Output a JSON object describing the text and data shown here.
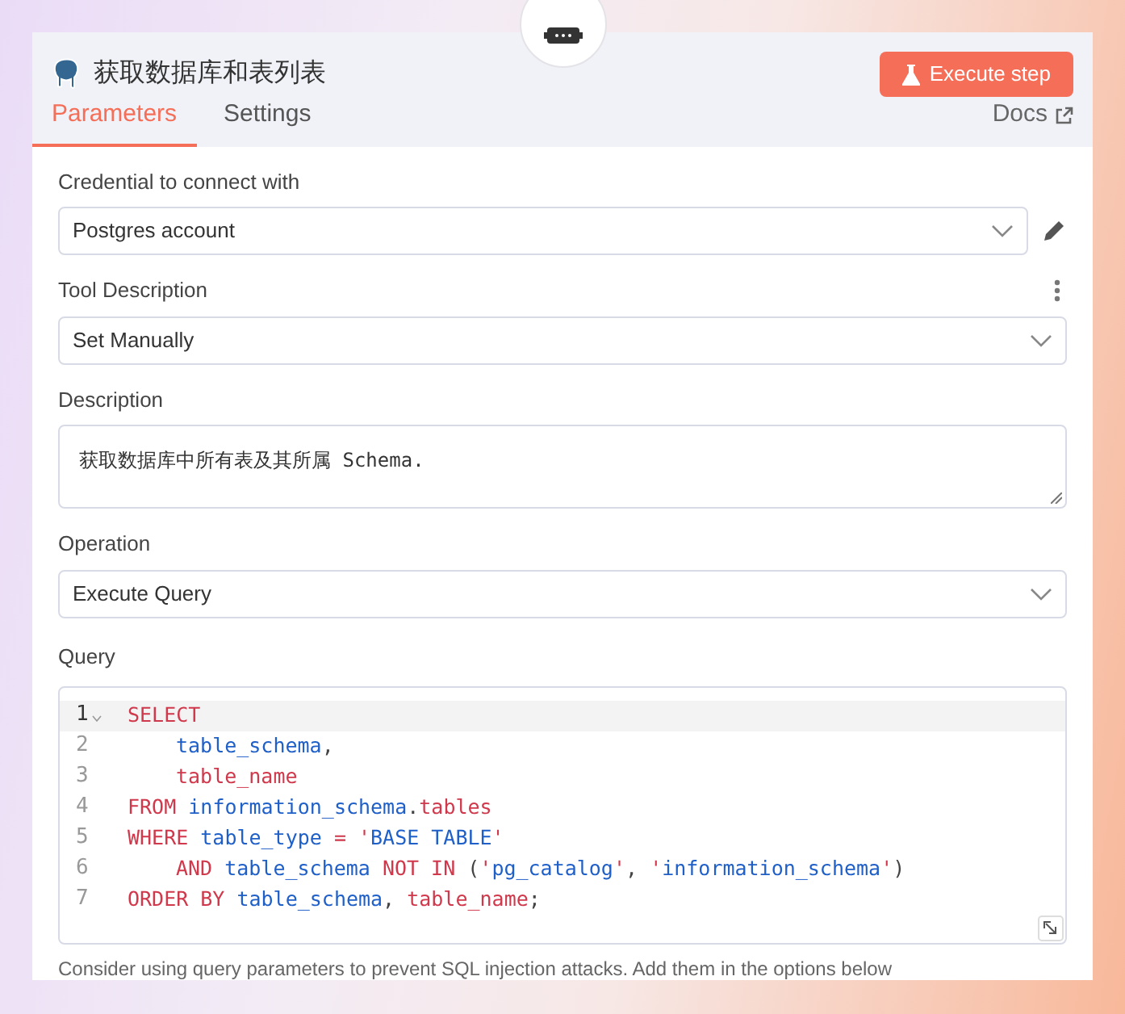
{
  "header": {
    "title": "获取数据库和表列表",
    "execute_button": "Execute step"
  },
  "tabs": [
    {
      "label": "Parameters",
      "selected": true
    },
    {
      "label": "Settings",
      "selected": false
    }
  ],
  "docs_link": "Docs",
  "fields": [
    {
      "kind": "select",
      "label": "Credential to connect with",
      "value": "Postgres account",
      "editable": true
    },
    {
      "kind": "select",
      "label": "Tool Description",
      "value": "Set Manually",
      "options_menu": true
    },
    {
      "kind": "textarea",
      "label": "Description",
      "value": "获取数据库中所有表及其所属 Schema."
    },
    {
      "kind": "select",
      "label": "Operation",
      "value": "Execute Query"
    }
  ],
  "query": {
    "label": "Query",
    "lines": [
      {
        "number": "1",
        "active": true,
        "indent": false,
        "tokens": [
          {
            "kind": "keyword",
            "text": "SELECT"
          }
        ]
      },
      {
        "number": "2",
        "active": false,
        "indent": true,
        "tokens": [
          {
            "kind": "identifier",
            "text": "table_schema"
          },
          {
            "kind": "plain",
            "text": ","
          }
        ]
      },
      {
        "number": "3",
        "active": false,
        "indent": true,
        "tokens": [
          {
            "kind": "keyword",
            "text": "table_name"
          }
        ]
      },
      {
        "number": "4",
        "active": false,
        "indent": false,
        "tokens": [
          {
            "kind": "keyword",
            "text": "FROM "
          },
          {
            "kind": "identifier",
            "text": "information_schema"
          },
          {
            "kind": "plain",
            "text": "."
          },
          {
            "kind": "keyword",
            "text": "tables"
          }
        ]
      },
      {
        "number": "5",
        "active": false,
        "indent": false,
        "tokens": [
          {
            "kind": "keyword",
            "text": "WHERE "
          },
          {
            "kind": "identifier",
            "text": "table_type "
          },
          {
            "kind": "keyword",
            "text": "= '"
          },
          {
            "kind": "identifier",
            "text": "BASE TABLE"
          },
          {
            "kind": "keyword",
            "text": "'"
          }
        ]
      },
      {
        "number": "6",
        "active": false,
        "indent": true,
        "tokens": [
          {
            "kind": "keyword",
            "text": "AND "
          },
          {
            "kind": "identifier",
            "text": "table_schema "
          },
          {
            "kind": "keyword",
            "text": "NOT IN "
          },
          {
            "kind": "plain",
            "text": "("
          },
          {
            "kind": "keyword",
            "text": "'"
          },
          {
            "kind": "identifier",
            "text": "pg_catalog"
          },
          {
            "kind": "keyword",
            "text": "'"
          },
          {
            "kind": "plain",
            "text": ", "
          },
          {
            "kind": "keyword",
            "text": "'"
          },
          {
            "kind": "identifier",
            "text": "information_schema"
          },
          {
            "kind": "keyword",
            "text": "'"
          },
          {
            "kind": "plain",
            "text": ")"
          }
        ]
      },
      {
        "number": "7",
        "active": false,
        "indent": false,
        "tokens": [
          {
            "kind": "keyword",
            "text": "ORDER BY "
          },
          {
            "kind": "identifier",
            "text": "table_schema"
          },
          {
            "kind": "plain",
            "text": ", "
          },
          {
            "kind": "keyword",
            "text": "table_name"
          },
          {
            "kind": "plain",
            "text": ";"
          }
        ]
      }
    ],
    "hint": "Consider using query parameters to prevent SQL injection attacks. Add them in the options below"
  }
}
